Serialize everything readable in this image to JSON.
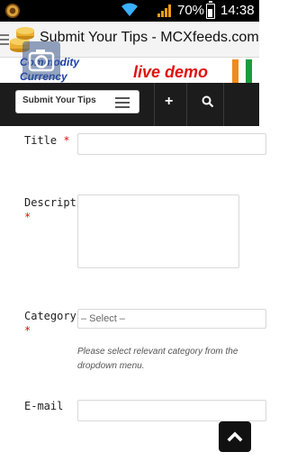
{
  "status_bar": {
    "battery_percent": "70%",
    "time": "14:38",
    "battery_level": 0.7
  },
  "title_bar": {
    "title": "Submit Your Tips - MCXfeeds.com"
  },
  "banner": {
    "brand_line1": "Commodity",
    "brand_line2": "Currency",
    "live_text": "live demo"
  },
  "nav": {
    "menu_select_label": "Submit Your Tips"
  },
  "form": {
    "title_label": "Title",
    "description_label": "Description",
    "category_label": "Category",
    "category_selected": "– Select –",
    "category_hint": "Please select relevant category from the dropdown menu.",
    "email_label": "E-mail",
    "required_mark": "*"
  },
  "colors": {
    "accent_red": "#d11111",
    "nav_bg": "#1c1c1c",
    "brand_blue": "#1b3fa6"
  }
}
